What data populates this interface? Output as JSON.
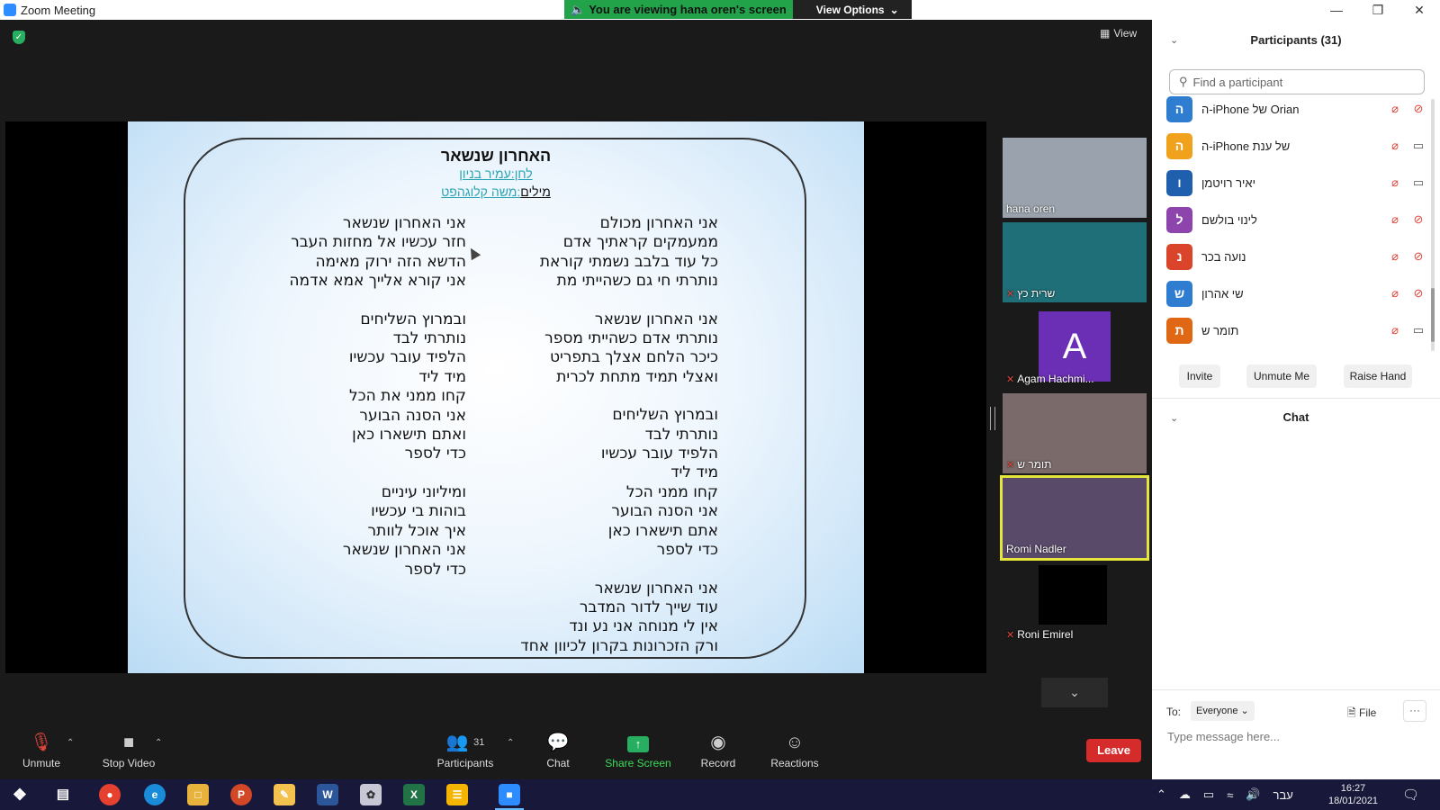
{
  "window": {
    "title": "Zoom Meeting",
    "banner": "You are viewing hana oren's screen",
    "view_options": "View Options",
    "view_label": "View"
  },
  "slide": {
    "title": "האחרון שנשאר",
    "credit1": "לחן:עמיר בניון",
    "credit2_label": "מילים",
    "credit2_value": ":משה קלוגהפט",
    "right_column": [
      [
        "אני האחרון מכולם",
        "ממעמקים קראתיך אדם",
        "כל עוד בלבב נשמתי קוראת",
        "נותרתי חי גם כשהייתי מת"
      ],
      [
        "אני האחרון שנשאר",
        "נותרתי אדם כשהייתי מספר",
        "כיכר הלחם אצלך בתפריט",
        "ואצלי תמיד מתחת לכרית"
      ],
      [
        "ובמרוץ השליחים",
        "נותרתי לבד",
        "הלפיד עובר עכשיו",
        "מיד ליד",
        "קחו ממני הכל",
        "אני הסנה הבוער",
        "אתם תישארו כאן",
        "כדי לספר"
      ],
      [
        "אני האחרון שנשאר",
        "עוד שייך לדור המדבר",
        "אין לי מנוחה אני נע ונד",
        "ורק הזכרונות בקרון לכיוון אחד"
      ]
    ],
    "left_column": [
      [
        "אני האחרון שנשאר",
        "חזר עכשיו אל מחזות העבר",
        "הדשא הזה ירוק מאימה",
        "אני קורא אלייך אמא אדמה"
      ],
      [
        "ובמרוץ השליחים",
        "נותרתי לבד",
        "הלפיד עובר עכשיו",
        "מיד ליד",
        "קחו ממני את הכל",
        "אני הסנה הבוער",
        "ואתם תישארו כאן",
        "כדי לספר"
      ],
      [
        "ומיליוני עיניים",
        "בוהות בי עכשיו",
        "איך אוכל לוותר",
        "אני האחרון שנשאר",
        "כדי לספר"
      ]
    ]
  },
  "thumbnails": [
    {
      "name": "hana oren",
      "muted": false,
      "avatar": ""
    },
    {
      "name": "שרית כץ",
      "muted": true,
      "avatar": ""
    },
    {
      "name": "Agam Hachmi...",
      "muted": true,
      "avatar": "A"
    },
    {
      "name": "תומר ש",
      "muted": true,
      "avatar": ""
    },
    {
      "name": "Romi Nadler",
      "muted": false,
      "avatar": ""
    },
    {
      "name": "Roni Emirel",
      "muted": true,
      "avatar": ""
    }
  ],
  "toolbar": {
    "unmute": "Unmute",
    "stop_video": "Stop Video",
    "participants": "Participants",
    "participants_count": "31",
    "chat": "Chat",
    "share_screen": "Share Screen",
    "record": "Record",
    "reactions": "Reactions",
    "leave": "Leave"
  },
  "panel": {
    "participants_title": "Participants (31)",
    "search_placeholder": "Find a participant",
    "participants": [
      {
        "initial": "ה",
        "name": "ה-iPhone של Orian",
        "color": "#2f7dd1",
        "video_off": true
      },
      {
        "initial": "ה",
        "name": "ה-iPhone של ענת",
        "color": "#f0a21c",
        "video_off": false
      },
      {
        "initial": "ו",
        "name": "יאיר רויטמן",
        "color": "#1f5fae",
        "video_off": false
      },
      {
        "initial": "ל",
        "name": "לינוי בולשם",
        "color": "#8e44ad",
        "video_off": true
      },
      {
        "initial": "נ",
        "name": "נועה בכר",
        "color": "#d9442b",
        "video_off": true
      },
      {
        "initial": "ש",
        "name": "שי אהרון",
        "color": "#2f7dd1",
        "video_off": true
      },
      {
        "initial": "ת",
        "name": "תומר ש",
        "color": "#e06714",
        "video_off": false
      }
    ],
    "invite": "Invite",
    "unmute_me": "Unmute Me",
    "raise_hand": "Raise Hand",
    "chat_title": "Chat",
    "to_label": "To:",
    "everyone": "Everyone",
    "file": "File",
    "message_placeholder": "Type message here..."
  },
  "taskbar": {
    "time": "16:27",
    "date": "18/01/2021",
    "lang": "עבר"
  }
}
